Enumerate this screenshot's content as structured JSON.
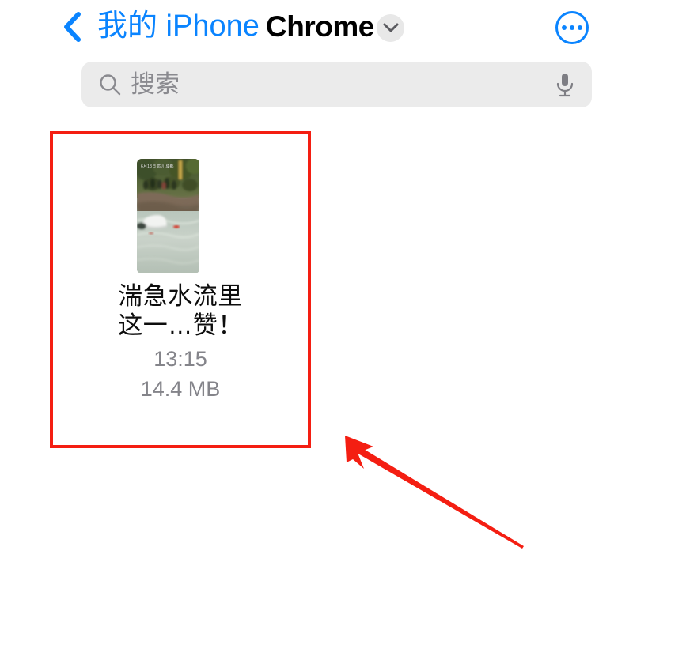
{
  "nav": {
    "back_label": "我的 iPhone",
    "back_icon": "chevron-left-icon",
    "title": "Chrome",
    "dropdown_icon": "chevron-down-icon",
    "more_icon": "ellipsis-circle-icon",
    "accent_color": "#0a84ff",
    "title_color": "#000000"
  },
  "search": {
    "placeholder": "搜索",
    "value": "",
    "search_icon": "search-icon",
    "mic_icon": "microphone-icon",
    "background_color": "#ebebeb",
    "text_color": "#8a8a8f"
  },
  "files": [
    {
      "name": "湍急水流里\n这一…赞！",
      "name_line1": "湍急水流里",
      "name_line2": "这一…赞！",
      "time": "13:15",
      "size": "14.4 MB",
      "thumbnail_watermark": "6月13日 四川成都",
      "thumbnail_type": "video-thumbnail",
      "meta_color": "#84848a"
    }
  ],
  "annotations": {
    "highlight_color": "#f41e12",
    "highlight_target": "file-item",
    "arrow_color": "#f41e12",
    "arrow_direction": "up-left"
  }
}
